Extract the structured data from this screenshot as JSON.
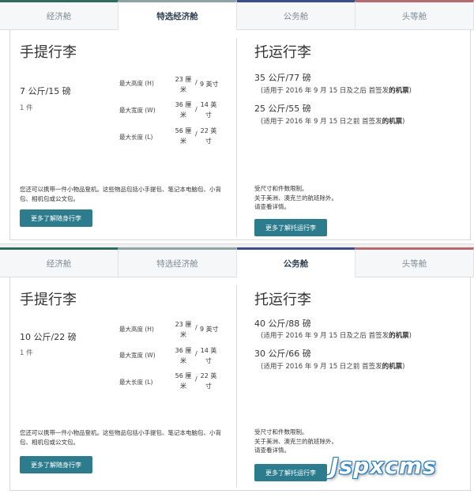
{
  "panels": [
    {
      "tabs": [
        {
          "label": "经济舱",
          "active": false
        },
        {
          "label": "特选经济舱",
          "active": true
        },
        {
          "label": "公务舱",
          "active": false
        },
        {
          "label": "头等舱",
          "active": false
        }
      ],
      "carry_on": {
        "title": "手提行李",
        "weight": "7 公斤/15 磅",
        "count": "1 件",
        "dims": [
          {
            "label": "最大高度 (H)",
            "cm": "23 厘米",
            "inch": "9 英寸"
          },
          {
            "label": "最大宽度 (W)",
            "cm": "36 厘米",
            "inch": "14 英寸"
          },
          {
            "label": "最大长度 (L)",
            "cm": "56 厘米",
            "inch": "22 英寸"
          }
        ],
        "note": "您还可以携带一件小物品登机。这些物品包括小手提包、笔记本电脑包、小背包、相机包或公文包。",
        "button": "更多了解随身行李"
      },
      "checked": {
        "title": "托运行李",
        "items": [
          {
            "weight": "35 公斤/77 磅",
            "note_pre": "(适用于 2016 年 9 月 15 日及之后 首签发",
            "note_bold": "的机票",
            "note_post": ")"
          },
          {
            "weight": "25 公斤/55 磅",
            "note_pre": "(适用于 2016 年 9 月 15 日之前 首签发",
            "note_bold": "的机票",
            "note_post": ")"
          }
        ],
        "note": [
          "受尺寸和件数限制。",
          "关于美洲、澳克兰的航班除外。",
          "请查看详情。"
        ],
        "button": "更多了解托运行李"
      }
    },
    {
      "tabs": [
        {
          "label": "经济舱",
          "active": false
        },
        {
          "label": "特选经济舱",
          "active": false
        },
        {
          "label": "公务舱",
          "active": true
        },
        {
          "label": "头等舱",
          "active": false
        }
      ],
      "carry_on": {
        "title": "手提行李",
        "weight": "10 公斤/22 磅",
        "count": "1 件",
        "dims": [
          {
            "label": "最大高度 (H)",
            "cm": "23 厘米",
            "inch": "9 英寸"
          },
          {
            "label": "最大宽度 (W)",
            "cm": "36 厘米",
            "inch": "14 英寸"
          },
          {
            "label": "最大长度 (L)",
            "cm": "56 厘米",
            "inch": "22 英寸"
          }
        ],
        "note": "您还可以携带一件小物品登机。这些物品包括小手提包、笔记本电脑包、小背包、相机包或公文包。",
        "button": "更多了解随身行李"
      },
      "checked": {
        "title": "托运行李",
        "items": [
          {
            "weight": "40 公斤/88 磅",
            "note_pre": "(适用于 2016 年 9 月 15 日及之后 首签发",
            "note_bold": "的机票",
            "note_post": ")"
          },
          {
            "weight": "30 公斤/66 磅",
            "note_pre": "(适用于 2016 年 9 月 15 日之前 首签发",
            "note_bold": "的机票",
            "note_post": ")"
          }
        ],
        "note": [
          "受尺寸和件数限制。",
          "关于美洲、澳克兰的航班除外。",
          "请查看详情。"
        ],
        "button": "更多了解托运行李"
      }
    }
  ],
  "watermark": "Jspxcms",
  "colors": {
    "button": "#2d7c8e",
    "economy_tab": "#2f6b5e",
    "premium_tab": "#8fa3a7",
    "business_tab": "#3b4e8a",
    "first_tab": "#b56a6f"
  }
}
